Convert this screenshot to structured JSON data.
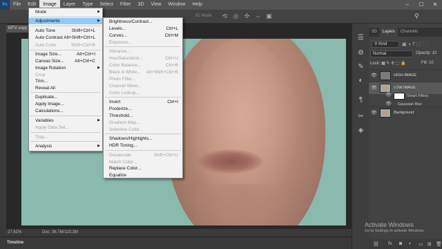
{
  "menubar": {
    "logo": "Ps",
    "items": [
      "File",
      "Edit",
      "Image",
      "Layer",
      "Type",
      "Select",
      "Filter",
      "3D",
      "View",
      "Window",
      "Help"
    ],
    "active_index": 2,
    "window_controls": [
      "–",
      "☐",
      "✕"
    ]
  },
  "options": {
    "mode_3d": "3D Mode:"
  },
  "document": {
    "tab": "MTV copy",
    "zoom": "27.61%",
    "doc_info": "Doc: 36.7M/110.2M"
  },
  "timeline": {
    "label": "Timeline"
  },
  "image_menu": {
    "items": [
      {
        "label": "Mode",
        "shortcut": "",
        "submenu": true,
        "disabled": false
      },
      {
        "label": "Adjustments",
        "shortcut": "",
        "submenu": true,
        "disabled": false,
        "highlighted": true
      },
      {
        "label": "Auto Tone",
        "shortcut": "Shift+Ctrl+L",
        "disabled": false
      },
      {
        "label": "Auto Contrast",
        "shortcut": "Alt+Shift+Ctrl+L",
        "disabled": false
      },
      {
        "label": "Auto Color",
        "shortcut": "Shift+Ctrl+B",
        "disabled": true
      },
      {
        "label": "Image Size...",
        "shortcut": "Alt+Ctrl+I",
        "disabled": false
      },
      {
        "label": "Canvas Size...",
        "shortcut": "Alt+Ctrl+C",
        "disabled": false
      },
      {
        "label": "Image Rotation",
        "shortcut": "",
        "submenu": true,
        "disabled": false
      },
      {
        "label": "Crop",
        "shortcut": "",
        "disabled": true
      },
      {
        "label": "Trim...",
        "shortcut": "",
        "disabled": false
      },
      {
        "label": "Reveal All",
        "shortcut": "",
        "disabled": false
      },
      {
        "label": "Duplicate...",
        "shortcut": "",
        "disabled": false
      },
      {
        "label": "Apply Image...",
        "shortcut": "",
        "disabled": false
      },
      {
        "label": "Calculations...",
        "shortcut": "",
        "disabled": false
      },
      {
        "label": "Variables",
        "shortcut": "",
        "submenu": true,
        "disabled": false
      },
      {
        "label": "Apply Data Set...",
        "shortcut": "",
        "disabled": true
      },
      {
        "label": "Trap...",
        "shortcut": "",
        "disabled": true
      },
      {
        "label": "Analysis",
        "shortcut": "",
        "submenu": true,
        "disabled": false
      }
    ]
  },
  "adjustments_menu": {
    "items": [
      {
        "label": "Brightness/Contrast...",
        "shortcut": "",
        "disabled": false
      },
      {
        "label": "Levels...",
        "shortcut": "Ctrl+L",
        "disabled": false
      },
      {
        "label": "Curves...",
        "shortcut": "Ctrl+M",
        "disabled": false
      },
      {
        "label": "Exposure...",
        "shortcut": "",
        "disabled": true
      },
      {
        "label": "Vibrance...",
        "shortcut": "",
        "disabled": true
      },
      {
        "label": "Hue/Saturation...",
        "shortcut": "Ctrl+U",
        "disabled": true
      },
      {
        "label": "Color Balance...",
        "shortcut": "Ctrl+B",
        "disabled": true
      },
      {
        "label": "Black & White...",
        "shortcut": "Alt+Shift+Ctrl+B",
        "disabled": true
      },
      {
        "label": "Photo Filter...",
        "shortcut": "",
        "disabled": true
      },
      {
        "label": "Channel Mixer...",
        "shortcut": "",
        "disabled": true
      },
      {
        "label": "Color Lookup...",
        "shortcut": "",
        "disabled": true
      },
      {
        "label": "Invert",
        "shortcut": "Ctrl+I",
        "disabled": false
      },
      {
        "label": "Posterize...",
        "shortcut": "",
        "disabled": false
      },
      {
        "label": "Threshold...",
        "shortcut": "",
        "disabled": false
      },
      {
        "label": "Gradient Map...",
        "shortcut": "",
        "disabled": true
      },
      {
        "label": "Selective Color...",
        "shortcut": "",
        "disabled": true
      },
      {
        "label": "Shadows/Highlights...",
        "shortcut": "",
        "disabled": false
      },
      {
        "label": "HDR Toning...",
        "shortcut": "",
        "disabled": false
      },
      {
        "label": "Desaturate",
        "shortcut": "Shift+Ctrl+U",
        "disabled": true
      },
      {
        "label": "Match Color...",
        "shortcut": "",
        "disabled": true
      },
      {
        "label": "Replace Color...",
        "shortcut": "",
        "disabled": false
      },
      {
        "label": "Equalize",
        "shortcut": "",
        "disabled": false
      }
    ]
  },
  "layers_panel": {
    "tabs": [
      "3D",
      "Layers",
      "Channels"
    ],
    "active_tab": "Layers",
    "filter_kind": "Kind",
    "blend_mode": "Normal",
    "opacity_label": "Opacity:",
    "opacity_value": "10",
    "lock_label": "Lock:",
    "fill_label": "Fill:",
    "fill_value": "10",
    "layers": [
      {
        "name": "HIGH IMAGE",
        "selected": false
      },
      {
        "name": "LOW IMAGE",
        "selected": true
      },
      {
        "name": "Smart Filters",
        "selected": false
      },
      {
        "name": "Gaussian Blur",
        "selected": false
      },
      {
        "name": "Background",
        "selected": false
      }
    ]
  },
  "watermark": {
    "title": "Activate Windows",
    "subtitle": "Go to Settings to activate Windows."
  }
}
